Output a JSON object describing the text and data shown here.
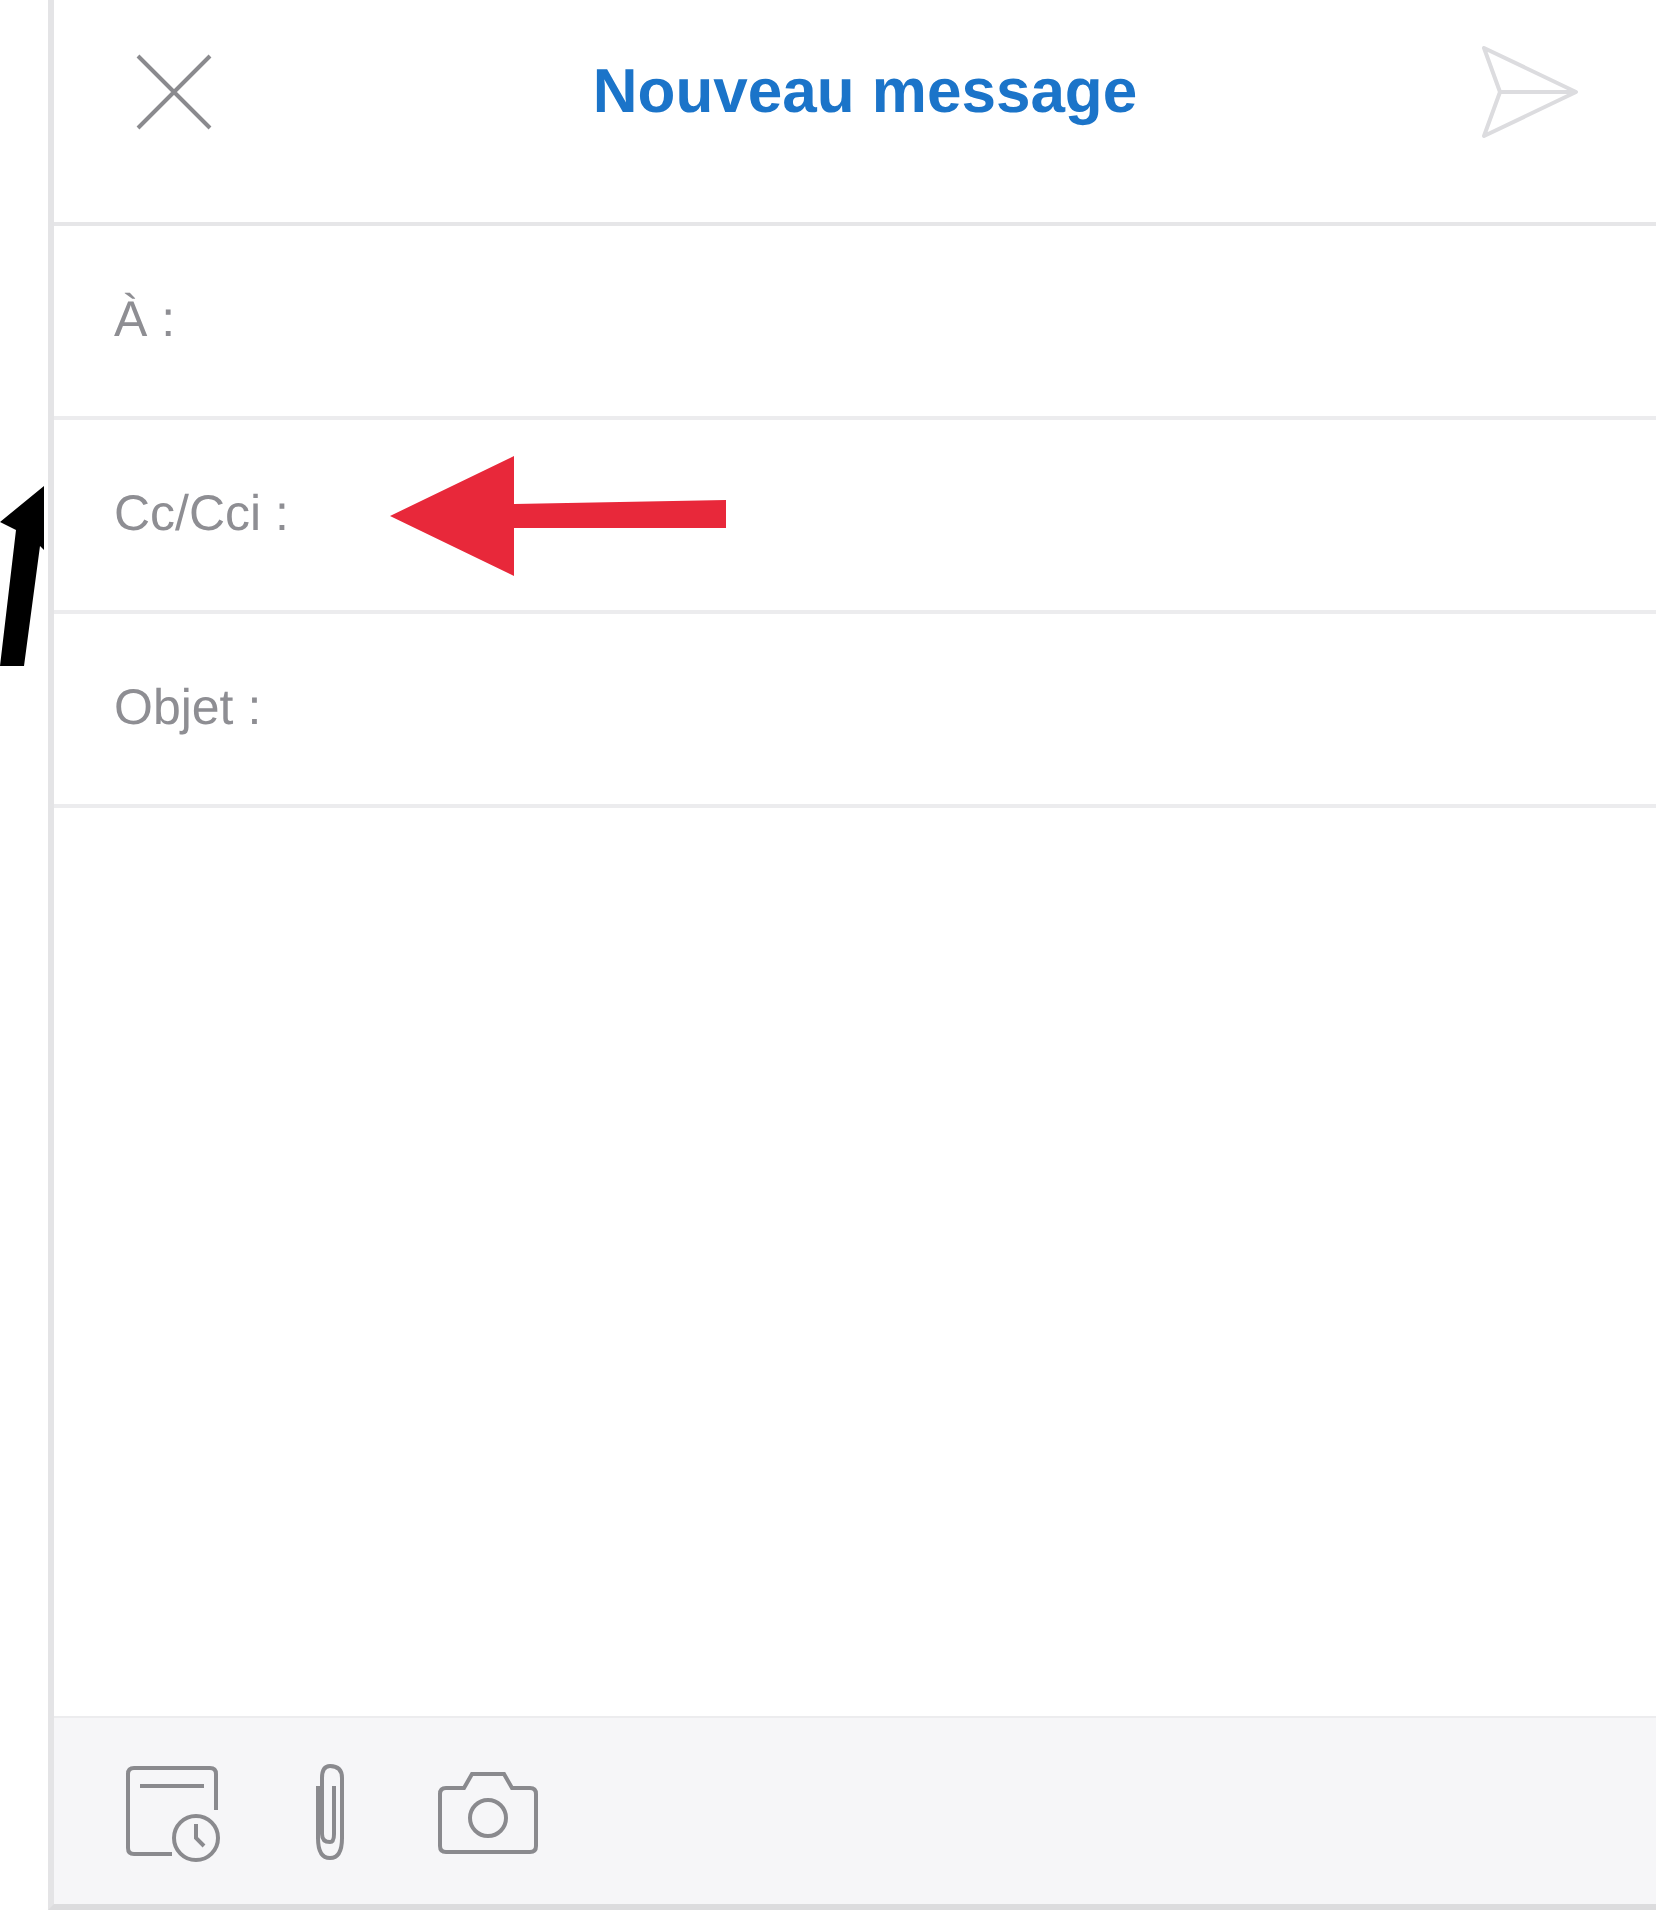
{
  "header": {
    "title": "Nouveau message"
  },
  "fields": [
    {
      "label": "À :"
    },
    {
      "label": "Cc/Cci :"
    },
    {
      "label": "Objet :"
    }
  ]
}
